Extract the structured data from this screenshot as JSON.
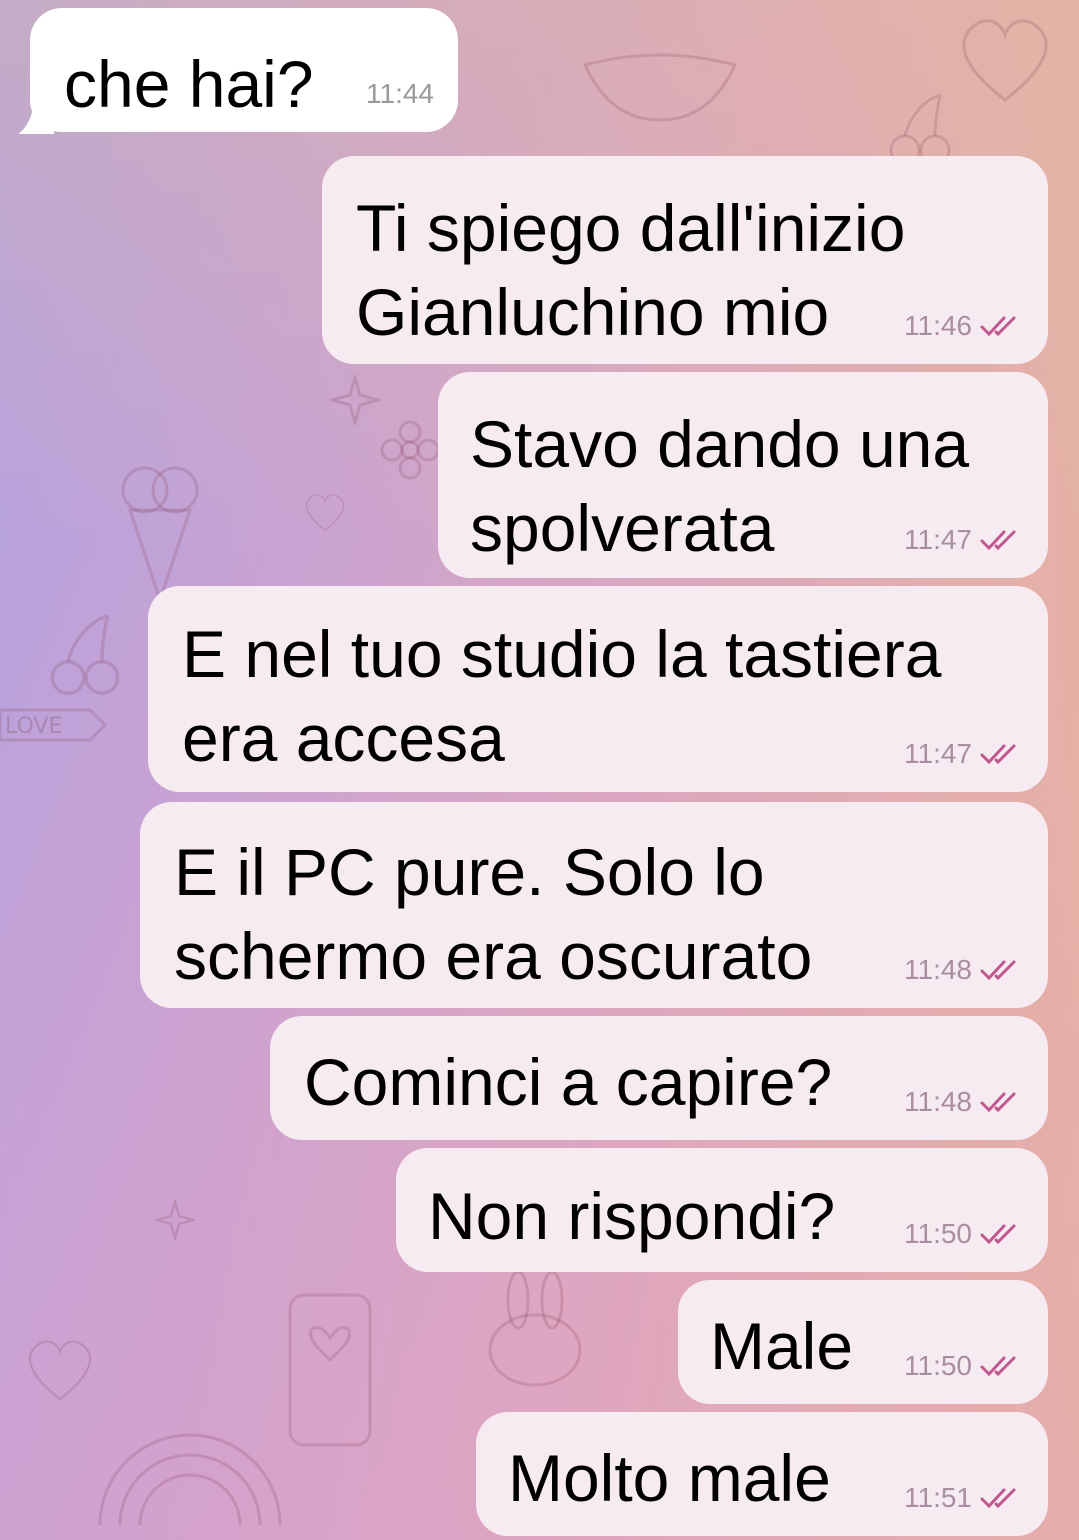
{
  "colors": {
    "incoming_bubble": "#ffffff",
    "outgoing_bubble": "#f7ebf2",
    "read_check": "#c0578f",
    "time_text": "#a88ea0"
  },
  "messages": [
    {
      "direction": "in",
      "text": "che hai?",
      "time": "11:44"
    },
    {
      "direction": "out",
      "text": "Ti spiego dall'inizio\nGianluchino mio",
      "time": "11:46",
      "status": "read"
    },
    {
      "direction": "out",
      "text": "Stavo dando una\nspolverata",
      "time": "11:47",
      "status": "read"
    },
    {
      "direction": "out",
      "text": "E nel tuo studio la tastiera\nera accesa",
      "time": "11:47",
      "status": "read"
    },
    {
      "direction": "out",
      "text": "E il PC pure. Solo lo\nschermo era oscurato",
      "time": "11:48",
      "status": "read"
    },
    {
      "direction": "out",
      "text": "Cominci a capire?",
      "time": "11:48",
      "status": "read"
    },
    {
      "direction": "out",
      "text": "Non rispondi?",
      "time": "11:50",
      "status": "read"
    },
    {
      "direction": "out",
      "text": "Male",
      "time": "11:50",
      "status": "read"
    },
    {
      "direction": "out",
      "text": "Molto male",
      "time": "11:51",
      "status": "read"
    }
  ],
  "wallpaper": {
    "icons": [
      "heart-icon",
      "cherry-icon",
      "ice-cream-icon",
      "sparkle-icon",
      "flower-icon",
      "ribbon-icon",
      "phone-icon",
      "bunny-icon",
      "rainbow-icon",
      "lips-icon"
    ],
    "ribbon_text": "LOVE"
  }
}
